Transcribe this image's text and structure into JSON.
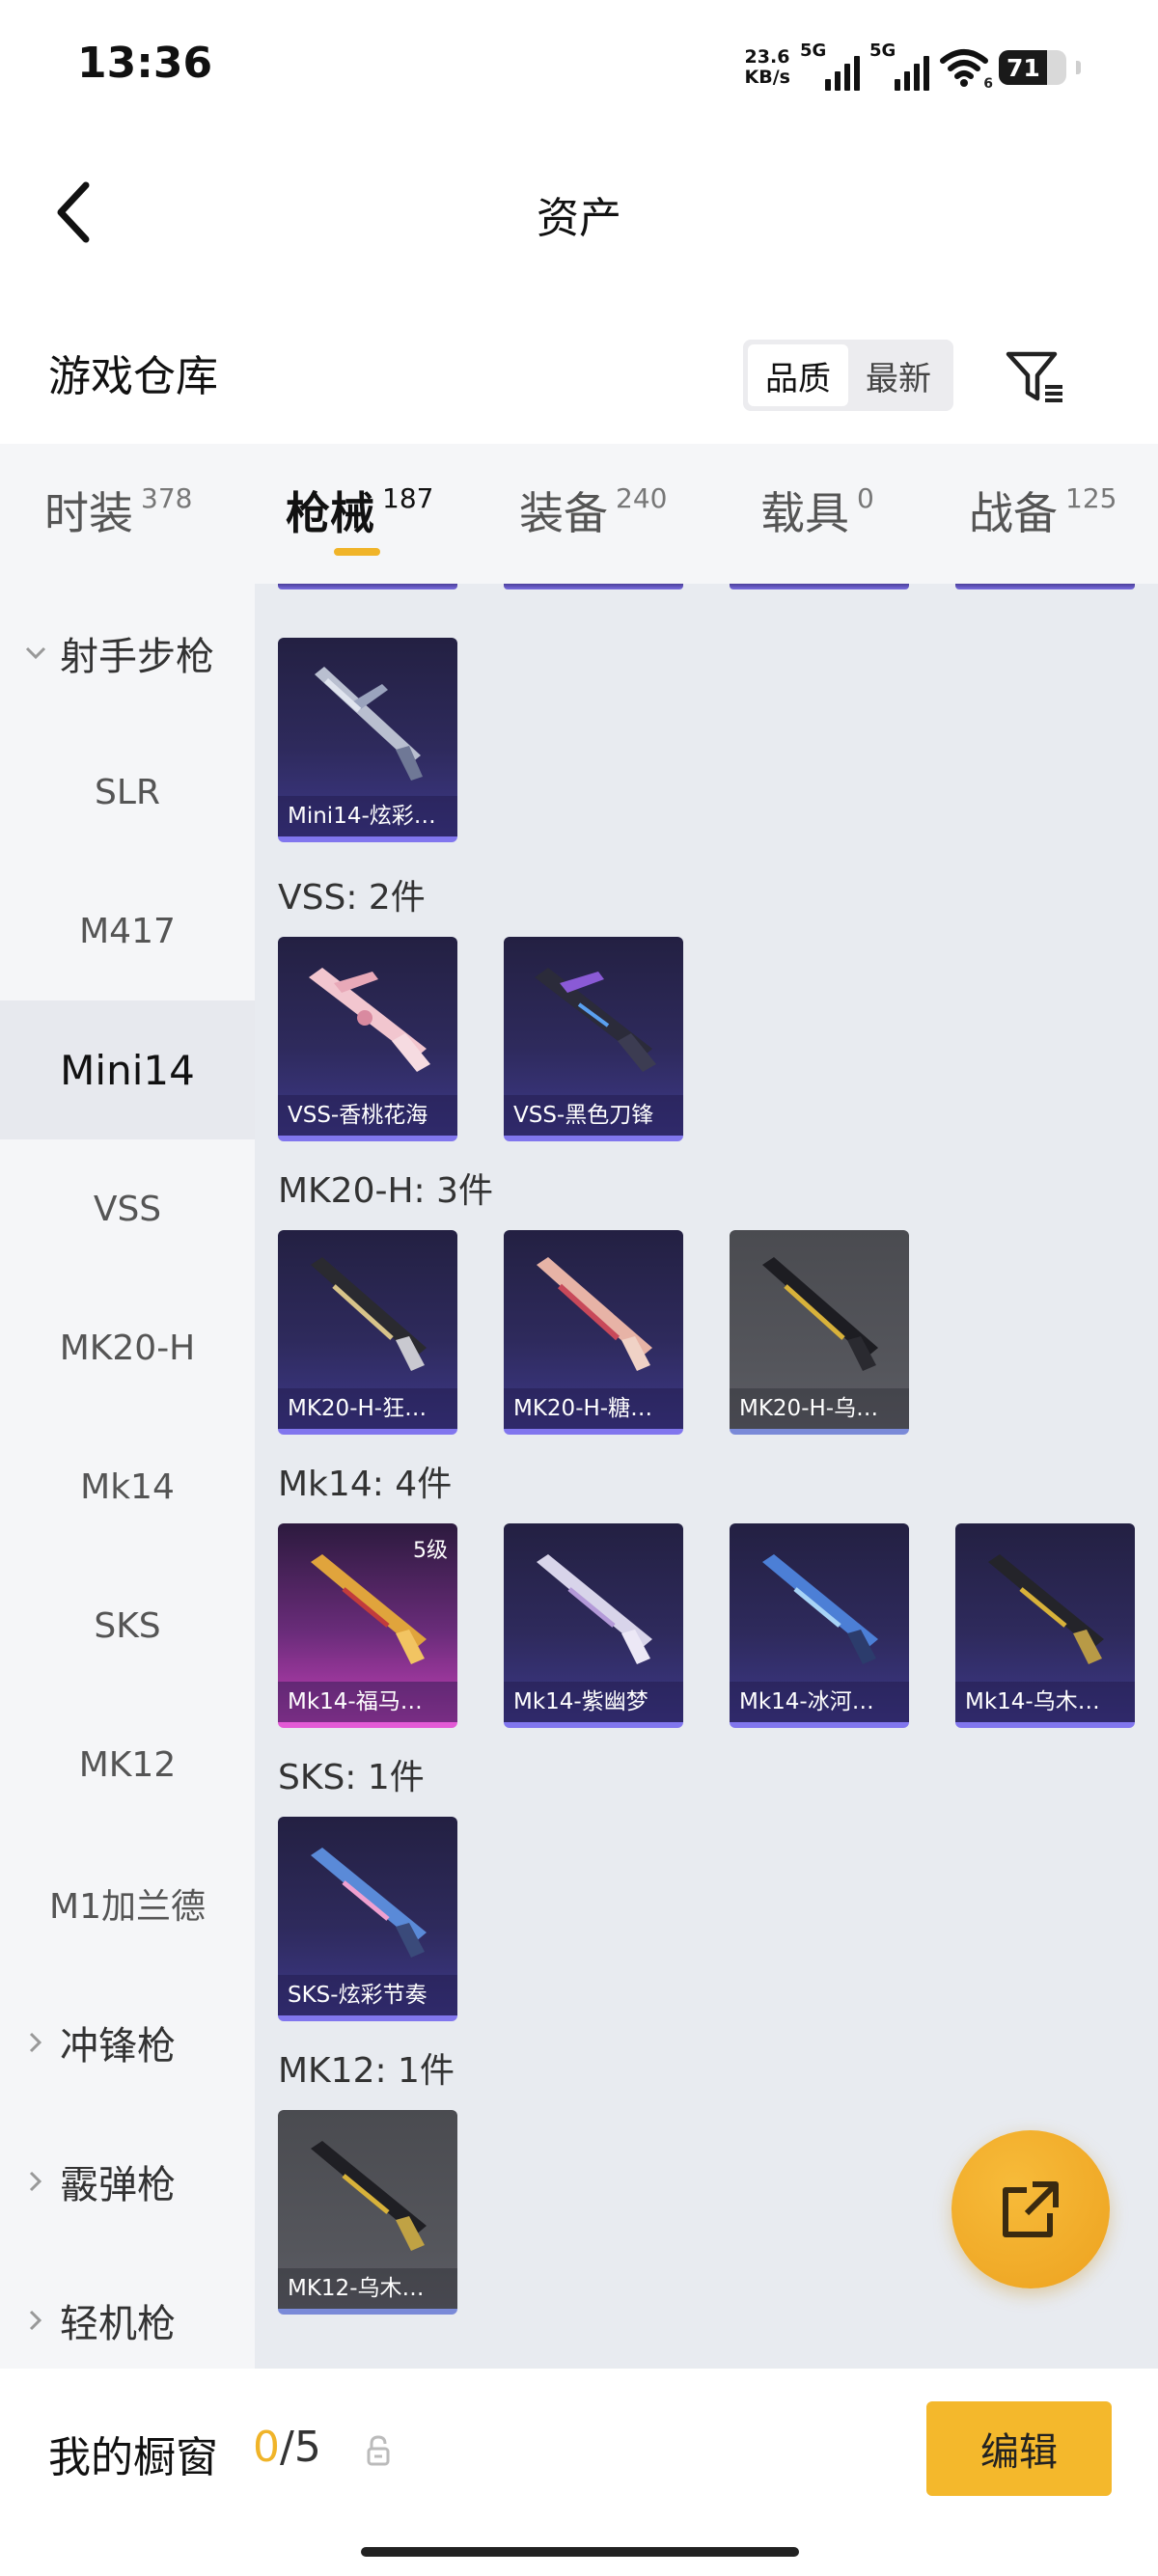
{
  "status": {
    "time": "13:36",
    "net_speed_value": "23.6",
    "net_speed_unit": "KB/s",
    "sim1_label": "5G",
    "sim2_label": "5G",
    "wifi_badge": "6",
    "battery_level": "71",
    "battery_fraction": 0.71
  },
  "nav": {
    "title": "资产",
    "back_icon": "chevron-left-icon"
  },
  "header": {
    "section_title": "游戏仓库",
    "sort_options": [
      "品质",
      "最新"
    ],
    "sort_active": "品质",
    "filter_icon": "filter-icon"
  },
  "tabs": [
    {
      "label": "时装",
      "count": "378"
    },
    {
      "label": "枪械",
      "count": "187",
      "active": true
    },
    {
      "label": "装备",
      "count": "240"
    },
    {
      "label": "载具",
      "count": "0"
    },
    {
      "label": "战备",
      "count": "125"
    }
  ],
  "sidebar": {
    "items": [
      {
        "label": "射手步枪",
        "type": "group",
        "expanded": true
      },
      {
        "label": "SLR"
      },
      {
        "label": "M417"
      },
      {
        "label": "Mini14",
        "active": true
      },
      {
        "label": "VSS"
      },
      {
        "label": "MK20-H"
      },
      {
        "label": "Mk14"
      },
      {
        "label": "SKS"
      },
      {
        "label": "MK12"
      },
      {
        "label": "M1加兰德"
      },
      {
        "label": "冲锋枪",
        "type": "group"
      },
      {
        "label": "霰弹枪",
        "type": "group"
      },
      {
        "label": "轻机枪",
        "type": "group"
      }
    ]
  },
  "groups": [
    {
      "title": "",
      "items": [
        {
          "name": "Mini14-炫彩…",
          "style": "purple"
        }
      ]
    },
    {
      "title": "VSS: 2件",
      "items": [
        {
          "name": "VSS-香桃花海",
          "style": "purple"
        },
        {
          "name": "VSS-黑色刀锋",
          "style": "purple"
        }
      ]
    },
    {
      "title": "MK20-H: 3件",
      "items": [
        {
          "name": "MK20-H-狂…",
          "style": "purple"
        },
        {
          "name": "MK20-H-糖…",
          "style": "purple"
        },
        {
          "name": "MK20-H-乌…",
          "style": "grey"
        }
      ]
    },
    {
      "title": "Mk14: 4件",
      "items": [
        {
          "name": "Mk14-福马…",
          "style": "pink",
          "level": "5级"
        },
        {
          "name": "Mk14-紫幽梦",
          "style": "purple"
        },
        {
          "name": "Mk14-冰河…",
          "style": "purple"
        },
        {
          "name": "Mk14-乌木…",
          "style": "purple"
        }
      ]
    },
    {
      "title": "SKS: 1件",
      "items": [
        {
          "name": "SKS-炫彩节奏",
          "style": "purple"
        }
      ]
    },
    {
      "title": "MK12: 1件",
      "items": [
        {
          "name": "MK12-乌木…",
          "style": "grey"
        }
      ]
    }
  ],
  "share_icon": "share-icon",
  "bottom": {
    "shelf_label": "我的橱窗",
    "shelf_current": "0",
    "shelf_total": "/5",
    "lock_icon": "lock-icon",
    "edit_label": "编辑"
  },
  "colors": {
    "accent": "#f0b429",
    "edit_button": "#f4b82c",
    "card_purple": "#3d3888",
    "card_pink": "#c23fb6",
    "main_bg": "#e8ebf0"
  }
}
